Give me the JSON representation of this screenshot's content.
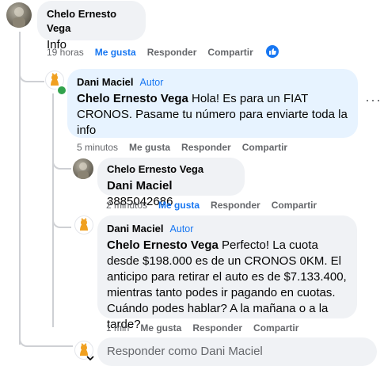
{
  "comments": [
    {
      "author": "Chelo Ernesto Vega",
      "text": "Info",
      "time": "19 horas",
      "like": "Me gusta",
      "reply": "Responder",
      "share": "Compartir"
    },
    {
      "author": "Dani Maciel",
      "badge": "Autor",
      "mention": "Chelo Ernesto Vega",
      "text": " Hola! Es para un FIAT CRONOS. Pasame tu número para enviarte toda la info",
      "time": "5 minutos",
      "like": "Me gusta",
      "reply": "Responder",
      "share": "Compartir"
    },
    {
      "author": "Chelo Ernesto Vega",
      "mention": "Dani Maciel",
      "text": " 3885042686",
      "time": "2 minutos",
      "like": "Me gusta",
      "reply": "Responder",
      "share": "Compartir"
    },
    {
      "author": "Dani Maciel",
      "badge": "Autor",
      "mention": "Chelo Ernesto Vega",
      "text": " Perfecto! La cuota desde $198.000 es de un CRONOS 0KM. El anticipo para retirar el auto es de $7.133.400, mientras tanto podes ir pagando en cuotas. Cuándo podes hablar? A la mañana o a la tarde?",
      "time": "1 min",
      "like": "Me gusta",
      "reply": "Responder",
      "share": "Compartir"
    }
  ],
  "reply_box": {
    "placeholder": "Responder como Dani Maciel"
  },
  "icons": {
    "more": "more-options-icon",
    "like_reaction": "thumbs-up-icon",
    "chevron": "chevron-down-icon"
  },
  "colors": {
    "accent": "#1877f2",
    "online": "#31a24c",
    "bubble_gray": "#f0f2f5",
    "bubble_blue": "#e7f3ff"
  }
}
